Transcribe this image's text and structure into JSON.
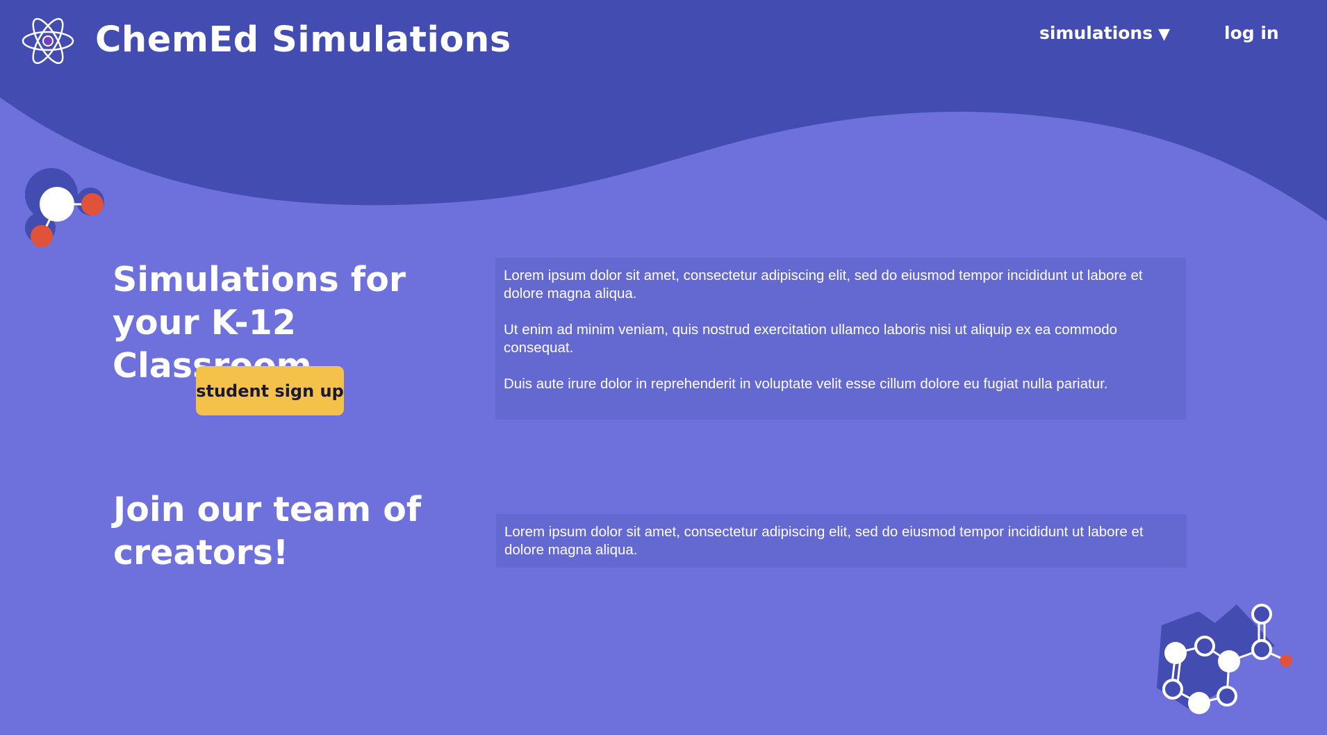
{
  "header": {
    "site_title": "ChemEd Simulations",
    "logo_icon": "atom-icon",
    "nav": {
      "simulations_label": "simulations",
      "simulations_caret": "▼",
      "login_label": "log in"
    }
  },
  "hero": {
    "title": "Simulations for your K-12 Classroom",
    "cta_label": "student sign up",
    "paragraphs": [
      "Lorem ipsum dolor sit amet, consectetur adipiscing elit, sed do eiusmod tempor incididunt ut labore et dolore magna aliqua.",
      "Ut enim ad minim veniam, quis nostrud exercitation ullamco laboris nisi ut aliquip ex ea commodo consequat.",
      "Duis aute irure dolor in reprehenderit in voluptate velit esse cillum dolore eu fugiat nulla pariatur."
    ]
  },
  "join": {
    "title": "Join our team of creators!",
    "paragraph": "Lorem ipsum dolor sit amet, consectetur adipiscing elit, sed do eiusmod tempor incididunt ut labore et dolore magna aliqua."
  },
  "colors": {
    "header_bg": "#434cb0",
    "page_bg": "#6e71db",
    "panel_bg": "#6469d2",
    "cta_bg": "#f4c14b",
    "accent_red": "#e0533a"
  }
}
